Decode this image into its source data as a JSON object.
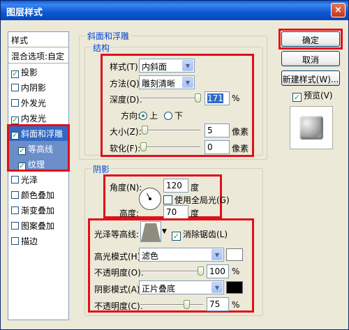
{
  "window": {
    "title": "图层样式",
    "close": "×"
  },
  "left_panel": {
    "header": "样式",
    "blend": "混合选项:自定",
    "items": [
      {
        "label": "投影",
        "checked": "✓"
      },
      {
        "label": "内阴影",
        "checked": ""
      },
      {
        "label": "外发光",
        "checked": ""
      },
      {
        "label": "内发光",
        "checked": "✓"
      },
      {
        "label": "斜面和浮雕",
        "checked": "✓"
      },
      {
        "label": "等高线",
        "checked": "✓"
      },
      {
        "label": "纹理",
        "checked": "✓"
      },
      {
        "label": "光泽",
        "checked": ""
      },
      {
        "label": "颜色叠加",
        "checked": ""
      },
      {
        "label": "渐变叠加",
        "checked": ""
      },
      {
        "label": "图案叠加",
        "checked": ""
      },
      {
        "label": "描边",
        "checked": ""
      }
    ]
  },
  "bevel": {
    "group_title": "斜面和浮雕",
    "structure_title": "结构",
    "style_label": "样式(T):",
    "style_value": "内斜面",
    "technique_label": "方法(Q):",
    "technique_value": "雕刻清晰",
    "depth_label": "深度(D):",
    "depth_value": "171",
    "depth_unit": "%",
    "direction_label": "方向:",
    "dir_up": "上",
    "dir_down": "下",
    "size_label": "大小(Z):",
    "size_value": "5",
    "size_unit": "像素",
    "soften_label": "软化(F):",
    "soften_value": "0",
    "soften_unit": "像素"
  },
  "shading": {
    "group_title": "阴影",
    "angle_label": "角度(N):",
    "angle_value": "120",
    "angle_unit": "度",
    "global_light": "使用全局光(G)",
    "altitude_label": "高度:",
    "altitude_value": "70",
    "altitude_unit": "度",
    "gloss_label": "光泽等高线:",
    "antialias": "消除锯齿(L)",
    "highlight_mode_label": "高光模式(H):",
    "highlight_mode_value": "滤色",
    "highlight_color": "#ffffff",
    "highlight_opacity_label": "不透明度(O):",
    "highlight_opacity_value": "100",
    "shadow_mode_label": "阴影模式(A):",
    "shadow_mode_value": "正片叠底",
    "shadow_color": "#000000",
    "shadow_opacity_label": "不透明度(C):",
    "shadow_opacity_value": "75",
    "percent": "%"
  },
  "right": {
    "ok": "确定",
    "cancel": "取消",
    "new_style": "新建样式(W)...",
    "preview": "预览(V)"
  }
}
